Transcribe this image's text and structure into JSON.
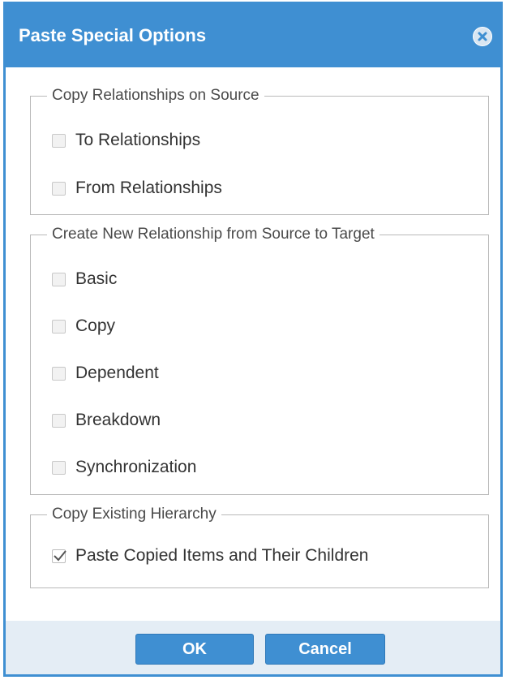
{
  "dialog": {
    "title": "Paste Special Options",
    "close_icon": "close-circle-icon"
  },
  "groups": [
    {
      "legend": "Copy Relationships on Source",
      "options": [
        {
          "label": "To Relationships",
          "checked": false
        },
        {
          "label": "From Relationships",
          "checked": false
        }
      ]
    },
    {
      "legend": "Create New Relationship from Source to Target",
      "options": [
        {
          "label": "Basic",
          "checked": false
        },
        {
          "label": "Copy",
          "checked": false
        },
        {
          "label": "Dependent",
          "checked": false
        },
        {
          "label": "Breakdown",
          "checked": false
        },
        {
          "label": "Synchronization",
          "checked": false
        }
      ]
    },
    {
      "legend": "Copy Existing Hierarchy",
      "options": [
        {
          "label": "Paste Copied Items and Their Children",
          "checked": true
        }
      ]
    }
  ],
  "buttons": {
    "ok": "OK",
    "cancel": "Cancel"
  },
  "colors": {
    "accent": "#3f8fd2",
    "footer": "#e4edf5"
  }
}
